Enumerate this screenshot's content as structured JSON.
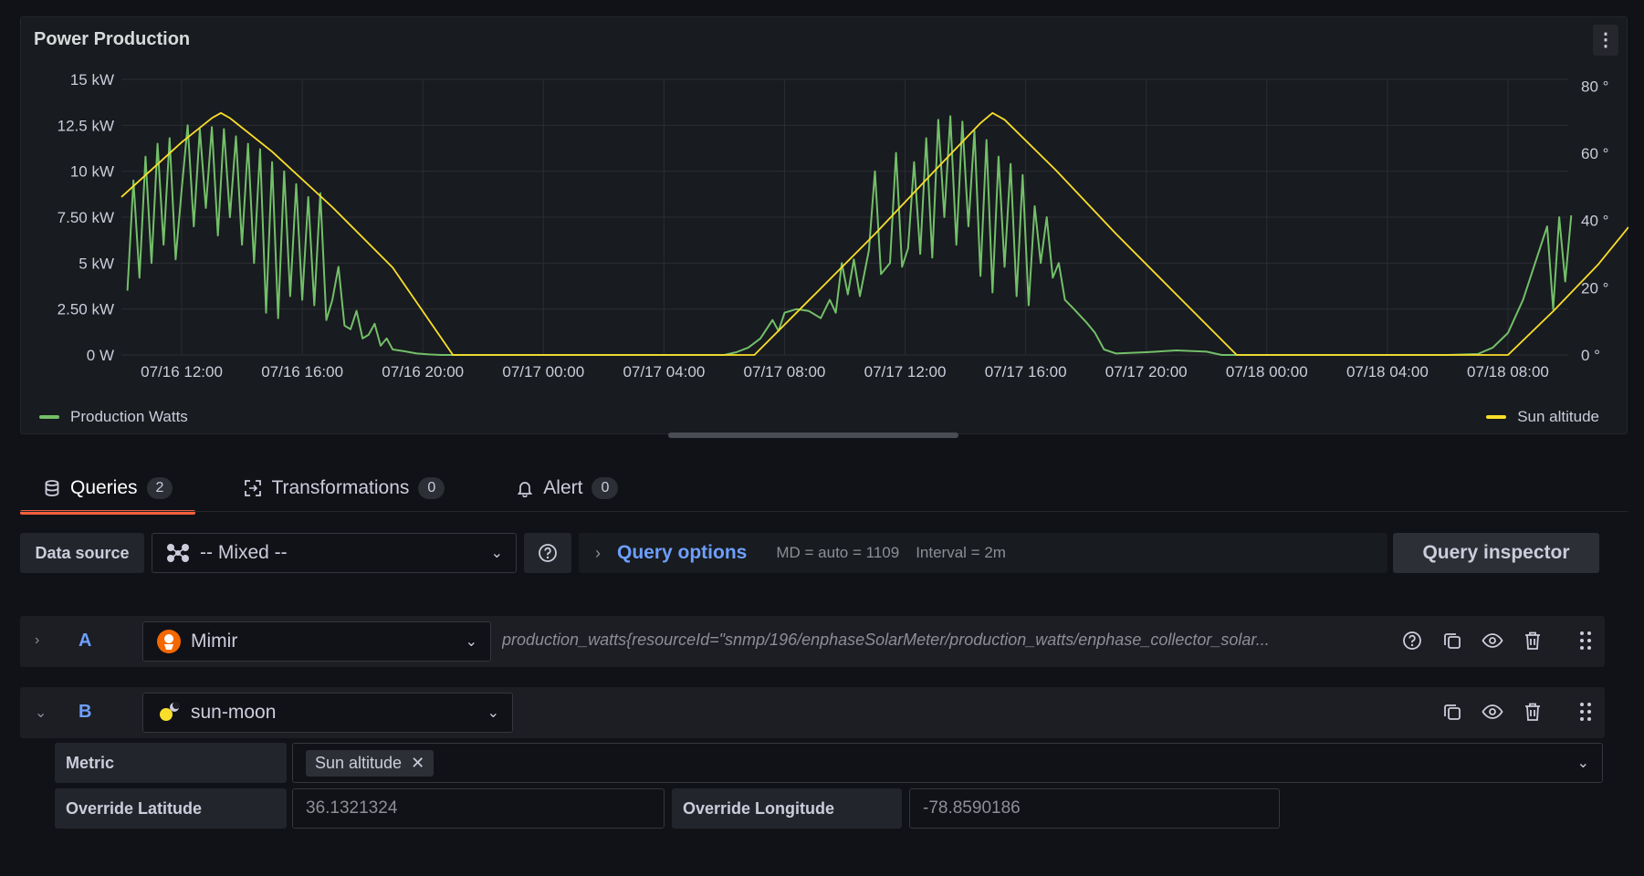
{
  "panel": {
    "title": "Power Production",
    "menu_glyph": "⋮"
  },
  "chart_data": {
    "type": "line",
    "title": "Power Production",
    "x_tick_labels": [
      "07/16 12:00",
      "07/16 16:00",
      "07/16 20:00",
      "07/17 00:00",
      "07/17 04:00",
      "07/17 08:00",
      "07/17 12:00",
      "07/17 16:00",
      "07/17 20:00",
      "07/18 00:00",
      "07/18 04:00",
      "07/18 08:00"
    ],
    "x_range_hours": [
      -2,
      46
    ],
    "y_left": {
      "ticks": [
        "0 W",
        "2.50 kW",
        "5 kW",
        "7.50 kW",
        "10 kW",
        "12.5 kW",
        "15 kW"
      ],
      "ylim": [
        0,
        15000
      ]
    },
    "y_right": {
      "ticks": [
        "0 °",
        "20 °",
        "40 °",
        "60 °",
        "80 °"
      ],
      "ylim": [
        0,
        82
      ]
    },
    "grid": true,
    "legend_placement": "bottom",
    "series": [
      {
        "name": "Production Watts",
        "axis": "left",
        "color": "#73bf69",
        "points": [
          [
            -1.8,
            3500
          ],
          [
            -1.6,
            9500
          ],
          [
            -1.4,
            4200
          ],
          [
            -1.2,
            10800
          ],
          [
            -1.0,
            5000
          ],
          [
            -0.8,
            11500
          ],
          [
            -0.6,
            6000
          ],
          [
            -0.4,
            11800
          ],
          [
            -0.2,
            5200
          ],
          [
            0,
            9000
          ],
          [
            0.2,
            12500
          ],
          [
            0.4,
            7000
          ],
          [
            0.6,
            12300
          ],
          [
            0.8,
            8000
          ],
          [
            1.0,
            12400
          ],
          [
            1.2,
            6500
          ],
          [
            1.4,
            12300
          ],
          [
            1.6,
            7500
          ],
          [
            1.8,
            11900
          ],
          [
            2.0,
            6000
          ],
          [
            2.2,
            11500
          ],
          [
            2.4,
            5000
          ],
          [
            2.6,
            11200
          ],
          [
            2.8,
            2300
          ],
          [
            3.0,
            10500
          ],
          [
            3.2,
            2000
          ],
          [
            3.4,
            10000
          ],
          [
            3.6,
            3200
          ],
          [
            3.8,
            9300
          ],
          [
            4.0,
            3000
          ],
          [
            4.2,
            8600
          ],
          [
            4.4,
            2700
          ],
          [
            4.6,
            8800
          ],
          [
            4.8,
            1900
          ],
          [
            5.0,
            3000
          ],
          [
            5.2,
            4800
          ],
          [
            5.4,
            1600
          ],
          [
            5.6,
            1400
          ],
          [
            5.8,
            2400
          ],
          [
            6.0,
            900
          ],
          [
            6.2,
            1100
          ],
          [
            6.4,
            1700
          ],
          [
            6.6,
            500
          ],
          [
            6.8,
            900
          ],
          [
            7.0,
            300
          ],
          [
            7.4,
            200
          ],
          [
            7.8,
            80
          ],
          [
            8.2,
            30
          ],
          [
            8.6,
            0
          ],
          [
            12,
            0
          ],
          [
            16,
            0
          ],
          [
            18.0,
            0
          ],
          [
            18.4,
            150
          ],
          [
            18.8,
            400
          ],
          [
            19.2,
            900
          ],
          [
            19.6,
            1900
          ],
          [
            19.8,
            1300
          ],
          [
            20.0,
            2300
          ],
          [
            20.4,
            2500
          ],
          [
            20.8,
            2400
          ],
          [
            21.2,
            2000
          ],
          [
            21.5,
            3000
          ],
          [
            21.7,
            2300
          ],
          [
            21.9,
            5000
          ],
          [
            22.1,
            3300
          ],
          [
            22.3,
            5200
          ],
          [
            22.5,
            3200
          ],
          [
            22.8,
            5700
          ],
          [
            23.0,
            10000
          ],
          [
            23.2,
            4400
          ],
          [
            23.5,
            5000
          ],
          [
            23.7,
            11000
          ],
          [
            23.9,
            4800
          ],
          [
            24.1,
            5800
          ],
          [
            24.3,
            10500
          ],
          [
            24.5,
            5500
          ],
          [
            24.7,
            11800
          ],
          [
            24.9,
            5300
          ],
          [
            25.1,
            12800
          ],
          [
            25.3,
            7500
          ],
          [
            25.5,
            13000
          ],
          [
            25.7,
            6000
          ],
          [
            25.9,
            12700
          ],
          [
            26.1,
            7000
          ],
          [
            26.3,
            12200
          ],
          [
            26.5,
            4300
          ],
          [
            26.7,
            11700
          ],
          [
            26.9,
            3400
          ],
          [
            27.1,
            10800
          ],
          [
            27.3,
            4800
          ],
          [
            27.5,
            10400
          ],
          [
            27.7,
            3200
          ],
          [
            27.9,
            9800
          ],
          [
            28.1,
            2700
          ],
          [
            28.3,
            8100
          ],
          [
            28.5,
            5000
          ],
          [
            28.7,
            7500
          ],
          [
            28.9,
            4200
          ],
          [
            29.1,
            5000
          ],
          [
            29.3,
            3000
          ],
          [
            29.6,
            2500
          ],
          [
            30.0,
            1800
          ],
          [
            30.3,
            1200
          ],
          [
            30.6,
            300
          ],
          [
            31.0,
            80
          ],
          [
            32.0,
            150
          ],
          [
            33.0,
            250
          ],
          [
            34.0,
            180
          ],
          [
            34.5,
            0
          ],
          [
            38,
            0
          ],
          [
            42,
            0
          ],
          [
            43.0,
            50
          ],
          [
            43.5,
            400
          ],
          [
            44.0,
            1200
          ],
          [
            44.5,
            3000
          ],
          [
            45.0,
            5500
          ],
          [
            45.3,
            7000
          ],
          [
            45.5,
            2500
          ],
          [
            45.7,
            7500
          ],
          [
            45.9,
            4000
          ],
          [
            46.1,
            7600
          ]
        ]
      },
      {
        "name": "Sun altitude",
        "axis": "right",
        "color": "#fade2a",
        "points": [
          [
            -2.0,
            47
          ],
          [
            0.0,
            63.3
          ],
          [
            1.0,
            70.5
          ],
          [
            1.3,
            72
          ],
          [
            1.6,
            70.5
          ],
          [
            3.0,
            60.5
          ],
          [
            5.0,
            44
          ],
          [
            7.0,
            26
          ],
          [
            9.0,
            0
          ],
          [
            19.0,
            0
          ],
          [
            21.0,
            18
          ],
          [
            23.0,
            36
          ],
          [
            25.0,
            55
          ],
          [
            26.5,
            69
          ],
          [
            26.9,
            72
          ],
          [
            27.3,
            70
          ],
          [
            29.0,
            55
          ],
          [
            31.0,
            36
          ],
          [
            33.0,
            18
          ],
          [
            35.0,
            0
          ],
          [
            44.0,
            0
          ],
          [
            45.5,
            13
          ],
          [
            47.0,
            27
          ],
          [
            48.0,
            38
          ]
        ]
      }
    ]
  },
  "legend": {
    "left_label": "Production Watts",
    "right_label": "Sun altitude"
  },
  "tabs": [
    {
      "label": "Queries",
      "count": "2"
    },
    {
      "label": "Transformations",
      "count": "0"
    },
    {
      "label": "Alert",
      "count": "0"
    }
  ],
  "datasource": {
    "label": "Data source",
    "value": "-- Mixed --"
  },
  "query_options": {
    "title": "Query options",
    "md": "MD = auto = 1109",
    "interval": "Interval = 2m"
  },
  "query_inspector_label": "Query inspector",
  "queries": [
    {
      "ref": "A",
      "datasource": "Mimir",
      "expression": "production_watts{resourceId=\"snmp/196/enphaseSolarMeter/production_watts/enphase_collector_solar..."
    },
    {
      "ref": "B",
      "datasource": "sun-moon"
    }
  ],
  "sun_moon": {
    "metric_label": "Metric",
    "metric_tag": "Sun altitude",
    "lat_label": "Override Latitude",
    "lat_value": "36.1321324",
    "lon_label": "Override Longitude",
    "lon_value": "-78.8590186"
  },
  "colors": {
    "production": "#73bf69",
    "sun": "#fade2a",
    "accent_tab": "#f55f3e",
    "link": "#6e9fff"
  }
}
